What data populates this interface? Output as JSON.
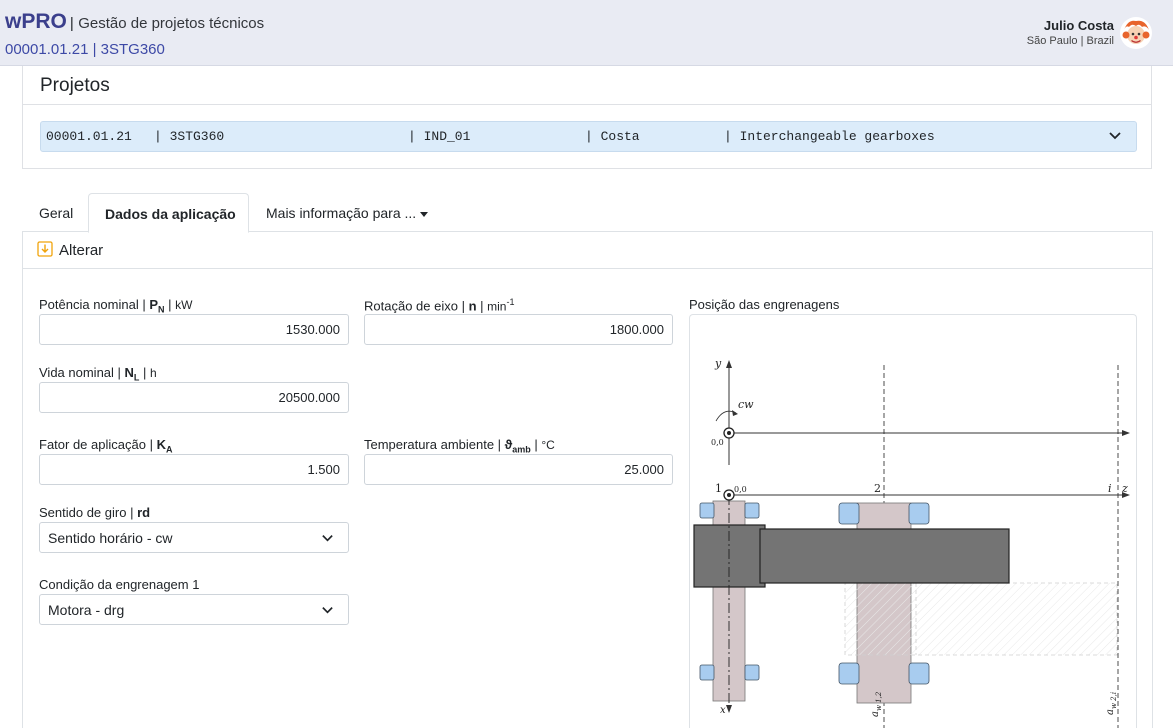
{
  "header": {
    "brand": "wPRO",
    "separator": "|",
    "subtitle": "Gestão de projetos técnicos",
    "project_code": "00001.01.21 | 3STG360",
    "user_name": "Julio Costa",
    "user_location": "São Paulo | Brazil"
  },
  "projects": {
    "title": "Projetos",
    "selected": {
      "code": "00001.01.21",
      "name": "| 3STG360",
      "ind": "| IND_01",
      "owner": "| Costa",
      "desc": "| Interchangeable gearboxes"
    }
  },
  "tabs": [
    {
      "label": "Geral"
    },
    {
      "label": "Dados da aplicação"
    },
    {
      "label": "Mais informação para ..."
    }
  ],
  "panel": {
    "action_label": "Alterar",
    "fields": {
      "power": {
        "label_pre": "Potência nominal | ",
        "sym": "P",
        "sub": "N",
        "label_post": " | ",
        "unit": "kW",
        "value": "1530.000"
      },
      "speed": {
        "label_pre": "Rotação de eixo | ",
        "sym": "n",
        "label_post": " | ",
        "unit": "min",
        "sup": "-1",
        "value": "1800.000"
      },
      "life": {
        "label_pre": "Vida nominal | ",
        "sym": "N",
        "sub": "L",
        "label_post": " | ",
        "unit": "h",
        "value": "20500.000"
      },
      "factor": {
        "label_pre": "Fator de aplicação | ",
        "sym": "K",
        "sub": "A",
        "value": "1.500"
      },
      "temp": {
        "label_pre": "Temperatura ambiente | ",
        "sym": "ϑ",
        "sub": "amb",
        "label_post": " | ",
        "unit": "°C",
        "value": "25.000"
      },
      "direction": {
        "label_pre": "Sentido de giro | ",
        "sym": "rd",
        "value": "Sentido horário - cw"
      },
      "condition": {
        "label": "Condição da engrenagem 1",
        "value": "Motora - drg"
      }
    },
    "diagram": {
      "title": "Posição das engrenagens",
      "axis_y": "y",
      "rot_label": "cw",
      "origin_label": "0,0",
      "axis_x": "x",
      "axis_z": "z",
      "gear1": "1",
      "gear2": "2",
      "gear_i": "i",
      "aw12": "a",
      "aw12_sub": "w 1,2",
      "aw2i": "a",
      "aw2i_sub": "w 2,i"
    }
  },
  "colors": {
    "brand": "#3b3f8c",
    "header_bg": "#e9ebf3",
    "select_bg": "#dcecfa",
    "gear_housing": "#747474",
    "shaft": "#d4c7c9",
    "bearing": "#a8ccef"
  }
}
